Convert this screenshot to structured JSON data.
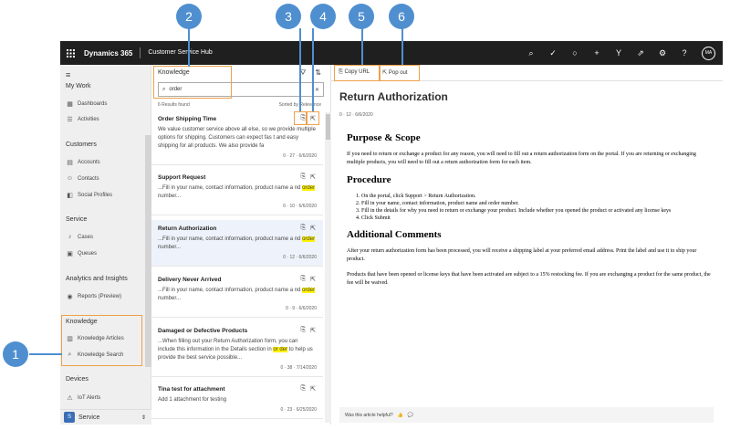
{
  "topbar": {
    "brand": "Dynamics 365",
    "app": "Customer Service Hub",
    "avatar": "MA"
  },
  "sidebar": {
    "sections": [
      {
        "title": "My Work",
        "items": [
          {
            "label": "Dashboards",
            "icon": "dashboard-icon"
          },
          {
            "label": "Activities",
            "icon": "activities-icon"
          }
        ]
      },
      {
        "title": "Customers",
        "items": [
          {
            "label": "Accounts",
            "icon": "accounts-icon"
          },
          {
            "label": "Contacts",
            "icon": "contacts-icon"
          },
          {
            "label": "Social Profiles",
            "icon": "social-icon"
          }
        ]
      },
      {
        "title": "Service",
        "items": [
          {
            "label": "Cases",
            "icon": "cases-icon"
          },
          {
            "label": "Queues",
            "icon": "queues-icon"
          }
        ]
      },
      {
        "title": "Analytics and Insights",
        "items": [
          {
            "label": "Reports (Preview)",
            "icon": "reports-icon"
          }
        ]
      },
      {
        "title": "Knowledge",
        "items": [
          {
            "label": "Knowledge Articles",
            "icon": "articles-icon"
          },
          {
            "label": "Knowledge Search",
            "icon": "search-icon"
          }
        ]
      },
      {
        "title": "Devices",
        "items": [
          {
            "label": "IoT Alerts",
            "icon": "iot-icon"
          }
        ]
      }
    ],
    "area_switcher": {
      "badge": "S",
      "label": "Service"
    }
  },
  "knowledge": {
    "title": "Knowledge",
    "search_value": "order",
    "results_count": "6 Results found",
    "sort_label": "Sorted by Relevance",
    "results": [
      {
        "title": "Order Shipping Time",
        "body_pre": "We value customer service above all else, so we provide multiple options for shipping. Customers can expect fas t and easy shipping for all products. We also provide fa",
        "hl": "",
        "body_post": "",
        "meta": "0 · 27 · 6/6/2020"
      },
      {
        "title": "Support Request",
        "body_pre": "...Fill in your name, contact information, product name a nd ",
        "hl": "order",
        "body_post": " number...",
        "meta": "0 · 10 · 6/6/2020"
      },
      {
        "title": "Return Authorization",
        "body_pre": "...Fill in your name, contact information, product name a nd ",
        "hl": "order",
        "body_post": " number...",
        "meta": "0 · 12 · 6/6/2020"
      },
      {
        "title": "Delivery Never Arrived",
        "body_pre": "...Fill in your name, contact information, product name a nd ",
        "hl": "order",
        "body_post": " number...",
        "meta": "0 · 9 · 6/6/2020"
      },
      {
        "title": "Damaged or Defective Products",
        "body_pre": "...When filling out your Return Authorization form, you can include this information in the Details section in ",
        "hl": "or der",
        "body_post": " to help us provide the best service possible...",
        "meta": "0 · 38 · 7/14/2020"
      },
      {
        "title": "Tina test for attachment",
        "body_pre": "Add 1 attachment for testing",
        "hl": "",
        "body_post": "",
        "meta": "0 · 23 · 6/25/2020"
      }
    ]
  },
  "article": {
    "toolbar": {
      "copy_url": "Copy URL",
      "pop_out": "Pop out"
    },
    "title": "Return Authorization",
    "meta": "0 · 12 · 6/6/2020",
    "h_purpose": "Purpose & Scope",
    "p_purpose": "If you need to return or exchange a product for any reason, you will need to fill out a return authorization form on the portal. If you are returning or exchanging multiple products, you will need to fill out a return authorization form for each item.",
    "h_procedure": "Procedure",
    "steps": [
      "On the portal, click Support > Return Authorization.",
      "Fill in your name, contact information, product name and order number.",
      "Fill in the details for why you need to return or exchange your product. Include whether you opened the product or activated any license keys",
      "Click Submit"
    ],
    "h_comments": "Additional Comments",
    "p_comments1": "After your return authorization form has been processed, you will receive a shipping label at your preferred email address. Print the label and use it to ship your product.",
    "p_comments2": "Products that have been opened or license keys that have been activated are subject to a 15% restocking fee. If you are exchanging a product for the same product, the fee will be waived.",
    "helpful": "Was this article helpful?"
  },
  "callouts": [
    "1",
    "2",
    "3",
    "4",
    "5",
    "6"
  ],
  "colors": {
    "callout": "#4f8fd0",
    "highlight_box": "#f0a04b",
    "search_hl": "#fff100"
  }
}
